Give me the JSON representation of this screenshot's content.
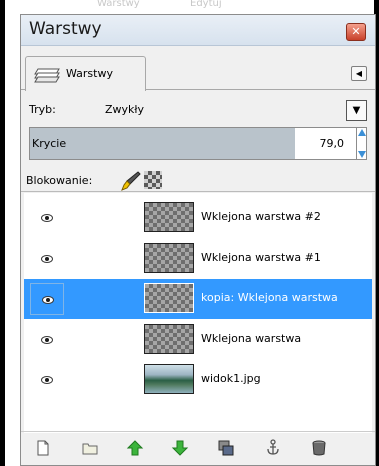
{
  "window": {
    "title": "Warstwy",
    "close_glyph": "✕"
  },
  "tab": {
    "label": "Warstwy",
    "icon": "layers-icon",
    "menu_glyph": "◀"
  },
  "mode": {
    "label": "Tryb:",
    "value": "Zwykły",
    "dropdown_glyph": "▼"
  },
  "opacity": {
    "label": "Krycie",
    "value": "79,0",
    "fraction": 0.79
  },
  "lock": {
    "label": "Blokowanie:",
    "icons": [
      "lock-pixels-brush-icon",
      "lock-alpha-icon"
    ]
  },
  "layers": [
    {
      "name": "Wklejona warstwa #2",
      "thumb": "transparent-checker",
      "visible": true,
      "selected": false
    },
    {
      "name": "Wklejona warstwa #1",
      "thumb": "transparent-checker",
      "visible": true,
      "selected": false
    },
    {
      "name": "kopia: Wklejona warstwa",
      "thumb": "transparent-checker",
      "visible": true,
      "selected": true
    },
    {
      "name": "Wklejona warstwa",
      "thumb": "transparent-checker",
      "visible": true,
      "selected": false
    },
    {
      "name": "widok1.jpg",
      "thumb": "landscape-photo",
      "visible": true,
      "selected": false
    }
  ],
  "bottom_toolbar": [
    "new-layer-icon",
    "new-group-icon",
    "raise-layer-icon",
    "lower-layer-icon",
    "duplicate-layer-icon",
    "anchor-layer-icon",
    "delete-layer-icon"
  ],
  "colors": {
    "selection": "#3399ff",
    "accent_arrow": "#3cb43c",
    "spin_arrow": "#3b8fd6",
    "close_button": "#c8402a"
  },
  "background_ghost_text": [
    "Warstwy",
    "Edytuj"
  ]
}
